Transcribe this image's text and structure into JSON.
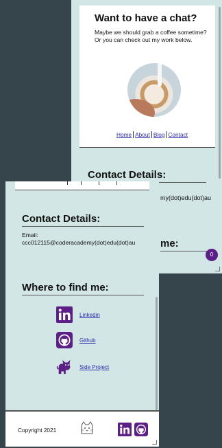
{
  "back_window": {
    "chat_title": "Want to have a chat?",
    "chat_text": "Maybe we should grab a coffee sometime? Or you can check out my work below.",
    "nav": [
      "Home",
      "About",
      "Blog",
      "Contact"
    ],
    "contact_title": "Contact Details:",
    "email_visible_tail": "my(dot)edu(dot)au",
    "where_title_tail": "me:",
    "badge_count": "0"
  },
  "front_window": {
    "contact_title": "Contact Details:",
    "email_label": "Email:",
    "email_value": "ccc012115@coderacademy(dot)edu(dot)au",
    "where_title": "Where to find me:",
    "links": [
      {
        "label": "Linkedin",
        "icon": "linkedin-icon"
      },
      {
        "label": "Github",
        "icon": "github-icon"
      },
      {
        "label": "Side Project",
        "icon": "cat-icon"
      }
    ],
    "footer": {
      "copyright": "Copyright 2021",
      "icons": [
        "cat-outline-logo",
        "linkedin-icon",
        "github-icon"
      ]
    }
  },
  "colors": {
    "background": "#36454b",
    "page": "#d3e6e6",
    "accent_purple": "#5b1f86",
    "link_blue": "#2b2bb0"
  }
}
